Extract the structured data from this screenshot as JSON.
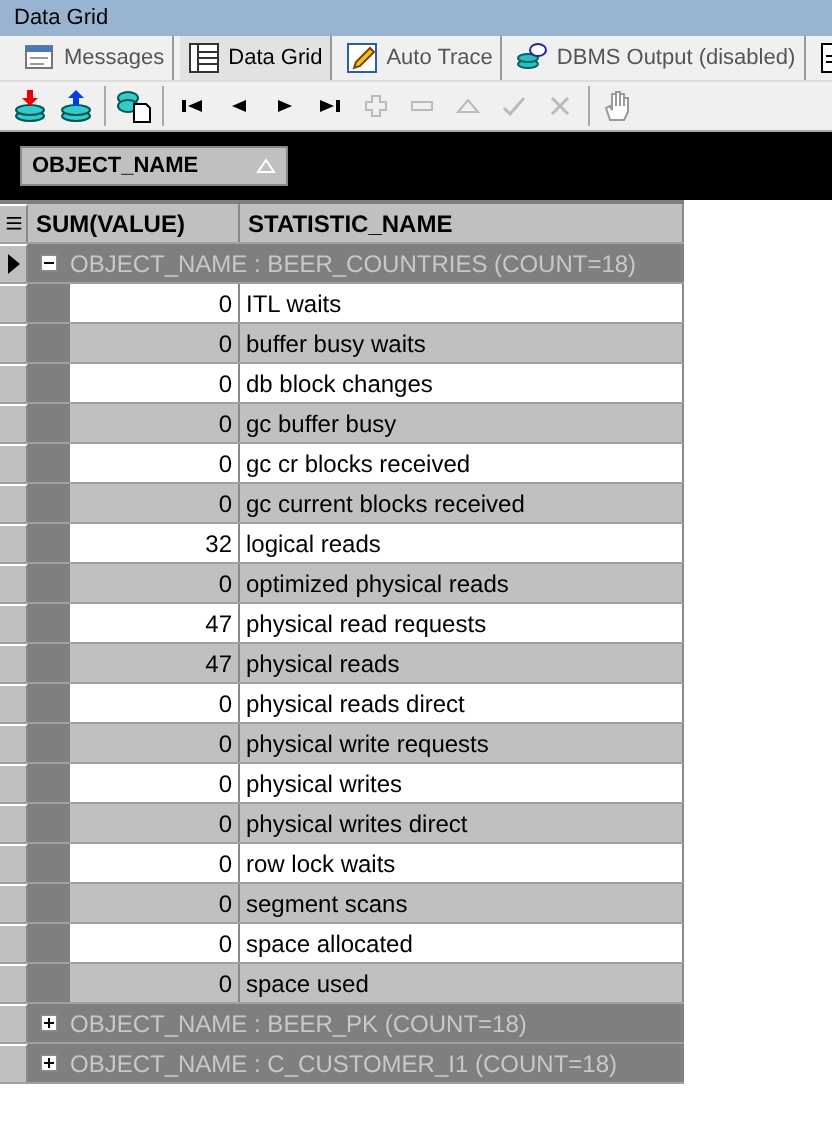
{
  "window": {
    "title": "Data Grid"
  },
  "tabs": [
    {
      "label": "Messages",
      "selected": false
    },
    {
      "label": "Data Grid",
      "selected": true
    },
    {
      "label": "Auto Trace",
      "selected": false
    },
    {
      "label": "DBMS Output (disabled)",
      "selected": false
    }
  ],
  "group_panel": {
    "column": "OBJECT_NAME"
  },
  "table": {
    "columns": [
      "SUM(VALUE)",
      "STATISTIC_NAME"
    ],
    "groups": [
      {
        "label": "OBJECT_NAME : BEER_COUNTRIES (COUNT=18)",
        "expanded": true,
        "current": true,
        "rows": [
          [
            "0",
            "ITL waits"
          ],
          [
            "0",
            "buffer busy waits"
          ],
          [
            "0",
            "db block changes"
          ],
          [
            "0",
            "gc buffer busy"
          ],
          [
            "0",
            "gc cr blocks received"
          ],
          [
            "0",
            "gc current blocks received"
          ],
          [
            "32",
            "logical reads"
          ],
          [
            "0",
            "optimized physical reads"
          ],
          [
            "47",
            "physical read requests"
          ],
          [
            "47",
            "physical reads"
          ],
          [
            "0",
            "physical reads direct"
          ],
          [
            "0",
            "physical write requests"
          ],
          [
            "0",
            "physical writes"
          ],
          [
            "0",
            "physical writes direct"
          ],
          [
            "0",
            "row lock waits"
          ],
          [
            "0",
            "segment scans"
          ],
          [
            "0",
            "space allocated"
          ],
          [
            "0",
            "space used"
          ]
        ]
      },
      {
        "label": "OBJECT_NAME : BEER_PK (COUNT=18)",
        "expanded": false,
        "current": false
      },
      {
        "label": "OBJECT_NAME : C_CUSTOMER_I1 (COUNT=18)",
        "expanded": false,
        "current": false
      }
    ]
  }
}
